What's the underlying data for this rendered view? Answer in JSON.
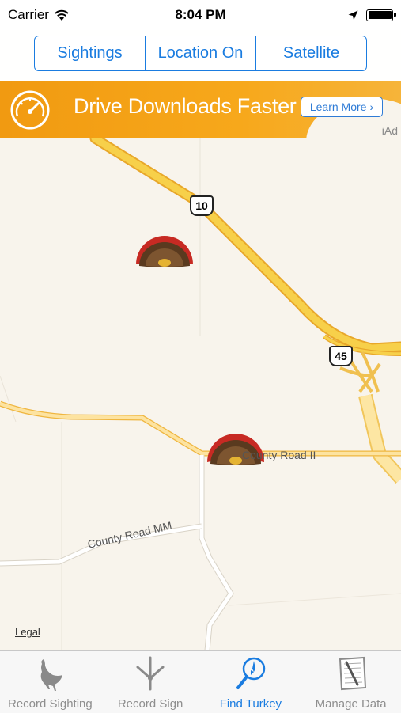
{
  "status_bar": {
    "carrier": "Carrier",
    "time": "8:04 PM"
  },
  "segmented": {
    "items": [
      "Sightings",
      "Location On",
      "Satellite"
    ]
  },
  "ad": {
    "headline": "Drive Downloads Faster",
    "button": "Learn More",
    "button_chevron": "›",
    "badge": "iAd"
  },
  "map": {
    "shields": [
      "10",
      "45"
    ],
    "roads": [
      "County Road II",
      "County Road MM"
    ],
    "legal": "Legal",
    "markers": [
      "turkey-marker",
      "turkey-marker"
    ]
  },
  "tabs": [
    {
      "label": "Record Sighting",
      "icon": "turkey-icon",
      "active": false
    },
    {
      "label": "Record Sign",
      "icon": "turkey-track-icon",
      "active": false
    },
    {
      "label": "Find Turkey",
      "icon": "compass-magnifier-icon",
      "active": true
    },
    {
      "label": "Manage Data",
      "icon": "notepad-icon",
      "active": false
    }
  ],
  "colors": {
    "accent": "#1a7ce0",
    "ad_orange": "#f19a11",
    "highway": "#f6c437",
    "map_bg": "#f8f4ec"
  }
}
